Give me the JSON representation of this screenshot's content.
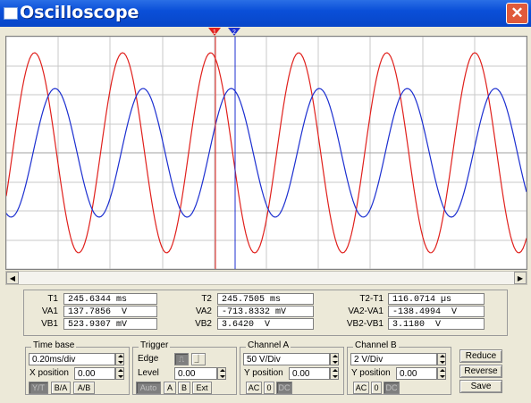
{
  "window": {
    "title": "Oscilloscope",
    "close_glyph": "✕"
  },
  "cursors": {
    "t1_label": "1",
    "t2_label": "2",
    "t1_color": "#e0201c",
    "t2_color": "#1c2fd0"
  },
  "signals": {
    "a_color": "#e0201c",
    "b_color": "#1c2fd0"
  },
  "readout": {
    "t1": {
      "label": "T1",
      "value": "245.6344 ms"
    },
    "va1": {
      "label": "VA1",
      "value": "137.7856  V"
    },
    "vb1": {
      "label": "VB1",
      "value": "523.9307 mV"
    },
    "t2": {
      "label": "T2",
      "value": "245.7505 ms"
    },
    "va2": {
      "label": "VA2",
      "value": "-713.8332 mV"
    },
    "vb2": {
      "label": "VB2",
      "value": "3.6420  V"
    },
    "dt": {
      "label": "T2-T1",
      "value": "116.0714 µs"
    },
    "dva": {
      "label": "VA2-VA1",
      "value": "-138.4994  V"
    },
    "dvb": {
      "label": "VB2-VB1",
      "value": "3.1180  V"
    }
  },
  "timebase": {
    "title": "Time base",
    "value": "0.20ms/div",
    "xpos_label": "X position",
    "xpos_value": "0.00",
    "modes": [
      "Y/T",
      "B/A",
      "A/B"
    ]
  },
  "trigger": {
    "title": "Trigger",
    "edge_label": "Edge",
    "level_label": "Level",
    "level_value": "0.00",
    "sources": [
      "Auto",
      "A",
      "B",
      "Ext"
    ]
  },
  "channel_a": {
    "title": "Channel A",
    "value": "50 V/Div",
    "ypos_label": "Y position",
    "ypos_value": "0.00",
    "coupling": [
      "AC",
      "0",
      "DC"
    ]
  },
  "channel_b": {
    "title": "Channel B",
    "value": "2 V/Div",
    "ypos_label": "Y position",
    "ypos_value": "0.00",
    "coupling": [
      "AC",
      "0",
      "DC"
    ]
  },
  "actions": {
    "reduce": "Reduce",
    "reverse": "Reverse",
    "save": "Save"
  }
}
